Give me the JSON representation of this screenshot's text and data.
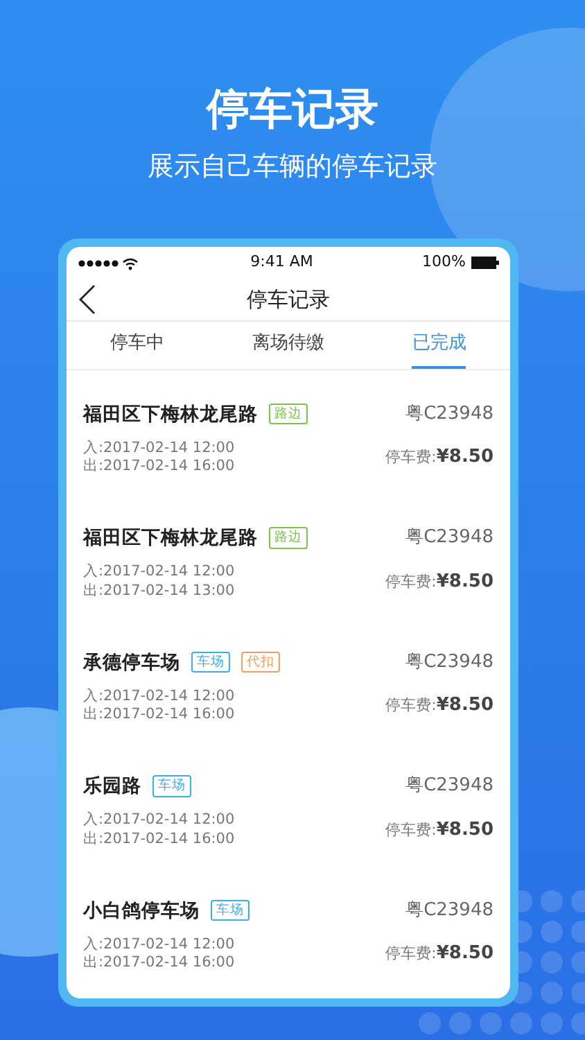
{
  "headline": "停车记录",
  "subtitle": "展示自己车辆的停车记录",
  "status_bar": {
    "time": "9:41 AM",
    "battery": "100%"
  },
  "nav": {
    "title": "停车记录"
  },
  "tabs": [
    {
      "label": "停车中",
      "selected": false
    },
    {
      "label": "离场待缴",
      "selected": false
    },
    {
      "label": "已完成",
      "selected": true
    }
  ],
  "records": [
    {
      "name": "福田区下梅林龙尾路",
      "tags": [
        {
          "text": "路边",
          "color": "#7cc24a"
        }
      ],
      "plate": "粤C23948",
      "entry": "入:2017-02-14 12:00",
      "exit": "出:2017-02-14 16:00",
      "fee_label": "停车费:",
      "fee": "¥8.50"
    },
    {
      "name": "福田区下梅林龙尾路",
      "tags": [
        {
          "text": "路边",
          "color": "#7cc24a"
        }
      ],
      "plate": "粤C23948",
      "entry": "入:2017-02-14 12:00",
      "exit": "出:2017-02-14 13:00",
      "fee_label": "停车费:",
      "fee": "¥8.50"
    },
    {
      "name": "承德停车场",
      "tags": [
        {
          "text": "车场",
          "color": "#3aaee8"
        },
        {
          "text": "代扣",
          "color": "#f0a060"
        }
      ],
      "plate": "粤C23948",
      "entry": "入:2017-02-14 12:00",
      "exit": "出:2017-02-14 16:00",
      "fee_label": "停车费:",
      "fee": "¥8.50"
    },
    {
      "name": "乐园路",
      "tags": [
        {
          "text": "车场",
          "color": "#3aaee8"
        }
      ],
      "plate": "粤C23948",
      "entry": "入:2017-02-14 12:00",
      "exit": "出:2017-02-14 16:00",
      "fee_label": "停车费:",
      "fee": "¥8.50"
    },
    {
      "name": "小白鸽停车场",
      "tags": [
        {
          "text": "车场",
          "color": "#3aaee8"
        }
      ],
      "plate": "粤C23948",
      "entry": "入:2017-02-14 12:00",
      "exit": "出:2017-02-14 16:00",
      "fee_label": "停车费:",
      "fee": "¥8.50"
    }
  ]
}
